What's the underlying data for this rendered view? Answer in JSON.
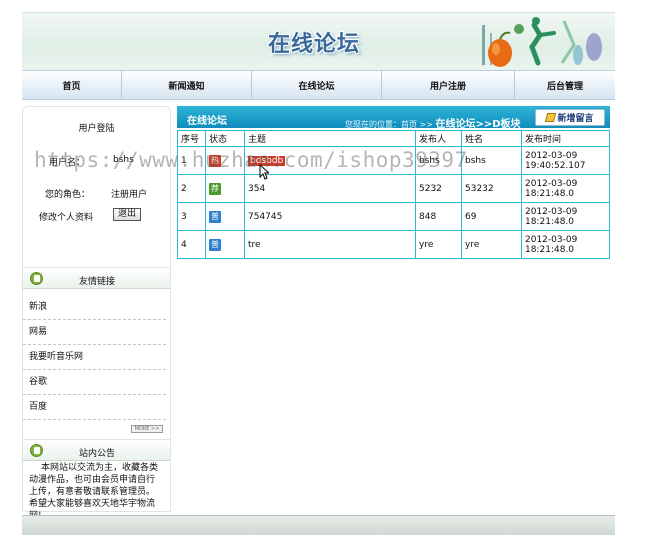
{
  "header": {
    "title": "在线论坛"
  },
  "nav": [
    {
      "label": "首页"
    },
    {
      "label": "新闻通知"
    },
    {
      "label": "在线论坛"
    },
    {
      "label": "用户注册"
    },
    {
      "label": "后台管理"
    }
  ],
  "login": {
    "title": "用户登陆",
    "username_label": "用户名：",
    "username_value": "bshs",
    "role_label": "您的角色：",
    "role_value": "注册用户",
    "edit_profile": "修改个人资料",
    "exit_button": "退出"
  },
  "links": {
    "title": "友情链接",
    "items": [
      "新浪",
      "网易",
      "我要听音乐网",
      "谷歌",
      "百度"
    ],
    "more": "MORE >>"
  },
  "notice": {
    "title": "站内公告",
    "text": "本网站以交流为主，收藏各类动漫作品，也可由会员申请自行上传，有意者敬请联系管理员。希望大家能够喜欢天地华宇物流网!"
  },
  "forum": {
    "title": "在线论坛",
    "location_label": "您现在的位置：首页 >>",
    "location_current": "在线论坛>>D板块",
    "new_post_label": "新增留言",
    "columns": [
      "序号",
      "状态",
      "主题",
      "发布人",
      "姓名",
      "发布时间"
    ],
    "rows": [
      {
        "no": "1",
        "status": "热",
        "subject": "bdsbdb",
        "author": "bshs",
        "name": "bshs",
        "time1": "2012-03-09",
        "time2": "19:40:52.107"
      },
      {
        "no": "2",
        "status": "荐",
        "subject": "354",
        "author": "5232",
        "name": "53232",
        "time1": "2012-03-09",
        "time2": "18:21:48.0"
      },
      {
        "no": "3",
        "status": "普",
        "subject": "754745",
        "author": "848",
        "name": "69",
        "time1": "2012-03-09",
        "time2": "18:21:48.0"
      },
      {
        "no": "4",
        "status": "普",
        "subject": "tre",
        "author": "yre",
        "name": "yre",
        "time1": "2012-03-09",
        "time2": "18:21:48.0"
      }
    ]
  },
  "watermark": "https://www.huzhan.com/ishop39397",
  "colors": {
    "accent": "#108cbc",
    "table_border": "#2bb9d6",
    "title": "#3a6a9a"
  }
}
